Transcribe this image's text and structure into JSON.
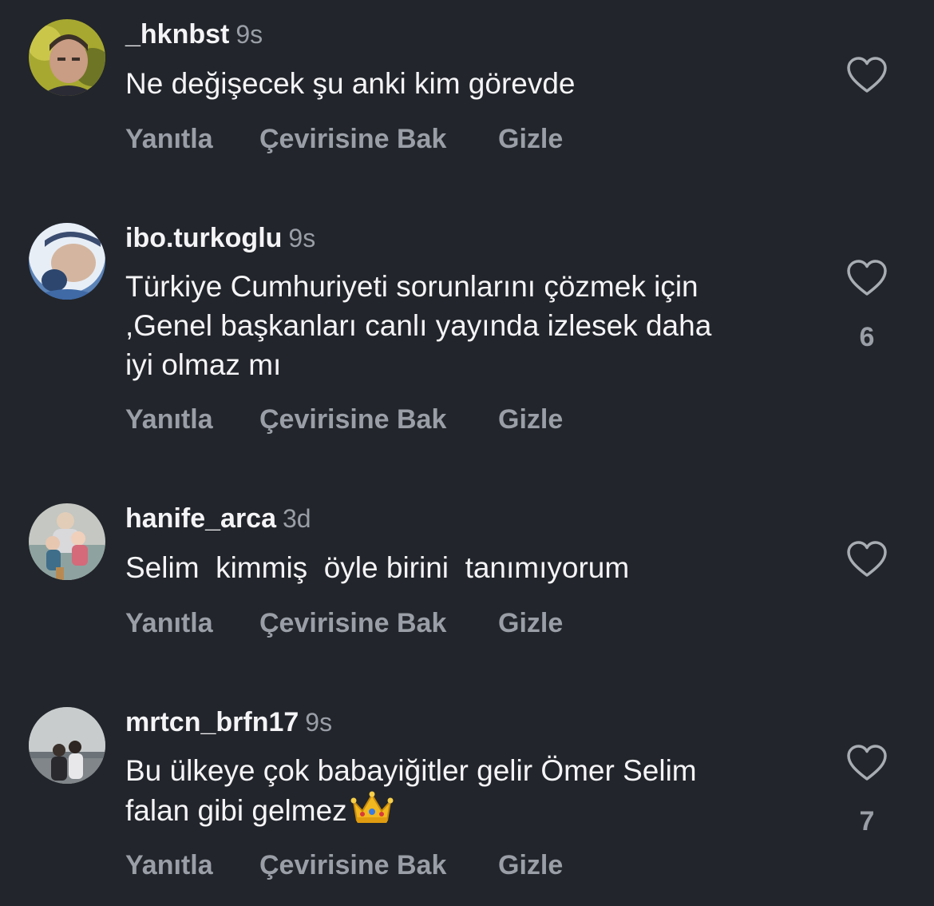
{
  "comments": [
    {
      "username": "_hknbst",
      "time": "9s",
      "text": "Ne değişecek şu anki kim görevde",
      "likes": "",
      "actions": {
        "reply": "Yanıtla",
        "translate": "Çevirisine Bak",
        "hide": "Gizle"
      }
    },
    {
      "username": "ibo.turkoglu",
      "time": "9s",
      "text": "Türkiye Cumhuriyeti sorunlarını çözmek için\n,Genel başkanları canlı yayında izlesek daha\niyi olmaz mı",
      "likes": "6",
      "actions": {
        "reply": "Yanıtla",
        "translate": "Çevirisine Bak",
        "hide": "Gizle"
      }
    },
    {
      "username": "hanife_arca",
      "time": "3d",
      "text": "Selim  kimmiş  öyle birini  tanımıyorum",
      "likes": "",
      "actions": {
        "reply": "Yanıtla",
        "translate": "Çevirisine Bak",
        "hide": "Gizle"
      }
    },
    {
      "username": "mrtcn_brfn17",
      "time": "9s",
      "text": "Bu ülkeye çok babayiğitler gelir Ömer Selim\nfalan gibi gelmez",
      "likes": "7",
      "actions": {
        "reply": "Yanıtla",
        "translate": "Çevirisine Bak",
        "hide": "Gizle"
      }
    }
  ],
  "icons": {
    "like": "heart-outline-icon",
    "crown_emoji": "crown-emoji"
  },
  "colors": {
    "background": "#22252b",
    "primary_text": "#f4f4f6",
    "secondary_text": "#9a9ea6"
  }
}
